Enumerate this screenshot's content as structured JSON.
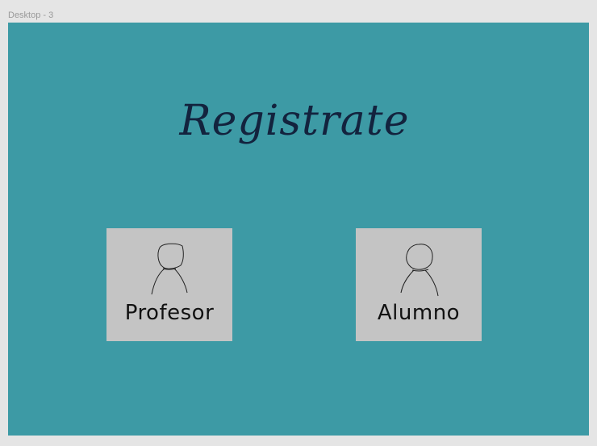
{
  "canvas": {
    "frame_label": "Desktop - 3",
    "background": "#3d9aa5"
  },
  "main": {
    "title": "Registrate",
    "title_color": "#13233e"
  },
  "options": [
    {
      "label": "Profesor",
      "icon": "user-sketch-icon"
    },
    {
      "label": "Alumno",
      "icon": "user-sketch-icon"
    }
  ],
  "card_color": "#c4c4c4"
}
